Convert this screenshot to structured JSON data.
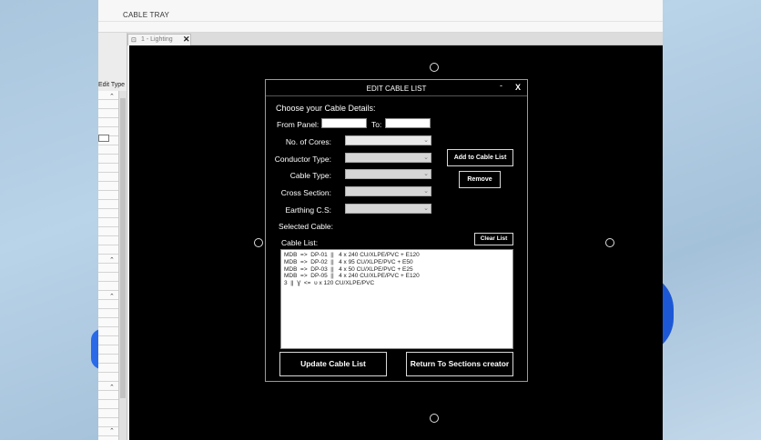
{
  "ribbon": {
    "tab_label": "CABLE TRAY"
  },
  "properties_panel": {
    "edit_type": "Edit Type"
  },
  "view_tab": {
    "label": "1 - Lighting",
    "close": "✕"
  },
  "dialog": {
    "title": "EDIT CABLE LIST",
    "minimize": "-",
    "close": "X",
    "heading": "Choose your Cable Details:",
    "from_panel_label": "From Panel:",
    "from_panel_value": "",
    "to_label": "To:",
    "to_value": "",
    "fields": [
      {
        "label": "No. of Cores:",
        "value": ""
      },
      {
        "label": "Conductor Type:",
        "value": ""
      },
      {
        "label": "Cable Type:",
        "value": ""
      },
      {
        "label": "Cross Section:",
        "value": ""
      },
      {
        "label": "Earthing C.S:",
        "value": ""
      }
    ],
    "selected_cable_label": "Selected Cable:",
    "cable_list_label": "Cable List:",
    "add_button": "Add to Cable List",
    "remove_button": "Remove",
    "clear_button": "Clear List",
    "cable_list": [
      "MDB  =>  DP-01  ||   4 x 240 CU/XLPE/PVC + E120",
      "MDB  =>  DP-02  ||   4 x 95 CU/XLPE/PVC + E50",
      "MDB  =>  DP-03  ||   4 x 50 CU/XLPE/PVC + E25",
      "MDB  =>  DP-05  ||   4 x 240 CU/XLPE/PVC + E120",
      "3  ||  Ɣ  <=  υ x 120 CU/XLPE/PVC"
    ],
    "update_button": "Update Cable List",
    "return_button": "Return To Sections creator"
  }
}
